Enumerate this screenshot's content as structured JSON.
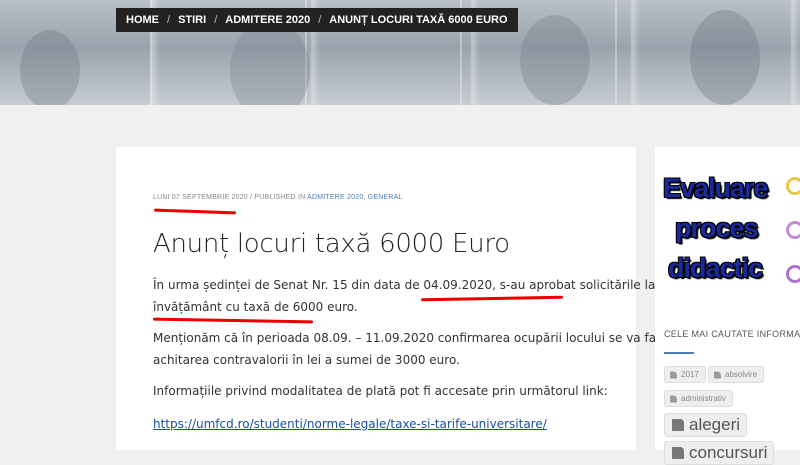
{
  "breadcrumb": {
    "home": "HOME",
    "stiri": "STIRI",
    "admitere": "ADMITERE 2020",
    "current": "ANUNȚ LOCURI TAXĂ 6000 EURO"
  },
  "post": {
    "date": "LUNI 07 SEPTEMBRIE 2020",
    "published_in": "PUBLISHED IN",
    "categories": "ADMITERE 2020, GENERAL",
    "title": "Anunț locuri taxă 6000 Euro",
    "para1_line1": "În urma ședinței de Senat Nr. 15 din data de 04.09.2020, s-au aprobat solicitările la forma de",
    "para1_line2": "învățământ cu taxă de 6000 euro.",
    "para2_line1": "Menționăm că în perioada 08.09. – 11.09.2020 confirmarea ocupării locului se va face prin",
    "para2_line2": "achitarea contravalorii în lei a sumei de 3000 euro.",
    "para3": "Informațiile privind modalitatea de plată pot fi accesate prin următorul link:",
    "link": "https://umfcd.ro/studenti/norme-legale/taxe-si-tarife-universitare/"
  },
  "sidebar": {
    "banner_lines": [
      "Evaluare",
      "proces",
      "didactic"
    ],
    "heading": "CELE MAI CAUTATE INFORMATII",
    "tags": [
      "2017",
      "absolvire",
      "administrativ",
      "alegeri",
      "concursuri"
    ]
  },
  "colors": {
    "accent": "#4a7fb5",
    "annotation": "#e00000",
    "banner_text": "#1a2a9a"
  }
}
